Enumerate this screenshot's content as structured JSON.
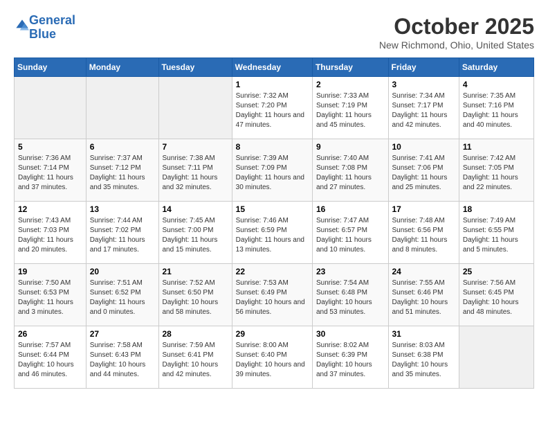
{
  "header": {
    "logo_line1": "General",
    "logo_line2": "Blue",
    "month": "October 2025",
    "location": "New Richmond, Ohio, United States"
  },
  "days_of_week": [
    "Sunday",
    "Monday",
    "Tuesday",
    "Wednesday",
    "Thursday",
    "Friday",
    "Saturday"
  ],
  "weeks": [
    [
      {
        "day": "",
        "info": ""
      },
      {
        "day": "",
        "info": ""
      },
      {
        "day": "",
        "info": ""
      },
      {
        "day": "1",
        "info": "Sunrise: 7:32 AM\nSunset: 7:20 PM\nDaylight: 11 hours and 47 minutes."
      },
      {
        "day": "2",
        "info": "Sunrise: 7:33 AM\nSunset: 7:19 PM\nDaylight: 11 hours and 45 minutes."
      },
      {
        "day": "3",
        "info": "Sunrise: 7:34 AM\nSunset: 7:17 PM\nDaylight: 11 hours and 42 minutes."
      },
      {
        "day": "4",
        "info": "Sunrise: 7:35 AM\nSunset: 7:16 PM\nDaylight: 11 hours and 40 minutes."
      }
    ],
    [
      {
        "day": "5",
        "info": "Sunrise: 7:36 AM\nSunset: 7:14 PM\nDaylight: 11 hours and 37 minutes."
      },
      {
        "day": "6",
        "info": "Sunrise: 7:37 AM\nSunset: 7:12 PM\nDaylight: 11 hours and 35 minutes."
      },
      {
        "day": "7",
        "info": "Sunrise: 7:38 AM\nSunset: 7:11 PM\nDaylight: 11 hours and 32 minutes."
      },
      {
        "day": "8",
        "info": "Sunrise: 7:39 AM\nSunset: 7:09 PM\nDaylight: 11 hours and 30 minutes."
      },
      {
        "day": "9",
        "info": "Sunrise: 7:40 AM\nSunset: 7:08 PM\nDaylight: 11 hours and 27 minutes."
      },
      {
        "day": "10",
        "info": "Sunrise: 7:41 AM\nSunset: 7:06 PM\nDaylight: 11 hours and 25 minutes."
      },
      {
        "day": "11",
        "info": "Sunrise: 7:42 AM\nSunset: 7:05 PM\nDaylight: 11 hours and 22 minutes."
      }
    ],
    [
      {
        "day": "12",
        "info": "Sunrise: 7:43 AM\nSunset: 7:03 PM\nDaylight: 11 hours and 20 minutes."
      },
      {
        "day": "13",
        "info": "Sunrise: 7:44 AM\nSunset: 7:02 PM\nDaylight: 11 hours and 17 minutes."
      },
      {
        "day": "14",
        "info": "Sunrise: 7:45 AM\nSunset: 7:00 PM\nDaylight: 11 hours and 15 minutes."
      },
      {
        "day": "15",
        "info": "Sunrise: 7:46 AM\nSunset: 6:59 PM\nDaylight: 11 hours and 13 minutes."
      },
      {
        "day": "16",
        "info": "Sunrise: 7:47 AM\nSunset: 6:57 PM\nDaylight: 11 hours and 10 minutes."
      },
      {
        "day": "17",
        "info": "Sunrise: 7:48 AM\nSunset: 6:56 PM\nDaylight: 11 hours and 8 minutes."
      },
      {
        "day": "18",
        "info": "Sunrise: 7:49 AM\nSunset: 6:55 PM\nDaylight: 11 hours and 5 minutes."
      }
    ],
    [
      {
        "day": "19",
        "info": "Sunrise: 7:50 AM\nSunset: 6:53 PM\nDaylight: 11 hours and 3 minutes."
      },
      {
        "day": "20",
        "info": "Sunrise: 7:51 AM\nSunset: 6:52 PM\nDaylight: 11 hours and 0 minutes."
      },
      {
        "day": "21",
        "info": "Sunrise: 7:52 AM\nSunset: 6:50 PM\nDaylight: 10 hours and 58 minutes."
      },
      {
        "day": "22",
        "info": "Sunrise: 7:53 AM\nSunset: 6:49 PM\nDaylight: 10 hours and 56 minutes."
      },
      {
        "day": "23",
        "info": "Sunrise: 7:54 AM\nSunset: 6:48 PM\nDaylight: 10 hours and 53 minutes."
      },
      {
        "day": "24",
        "info": "Sunrise: 7:55 AM\nSunset: 6:46 PM\nDaylight: 10 hours and 51 minutes."
      },
      {
        "day": "25",
        "info": "Sunrise: 7:56 AM\nSunset: 6:45 PM\nDaylight: 10 hours and 48 minutes."
      }
    ],
    [
      {
        "day": "26",
        "info": "Sunrise: 7:57 AM\nSunset: 6:44 PM\nDaylight: 10 hours and 46 minutes."
      },
      {
        "day": "27",
        "info": "Sunrise: 7:58 AM\nSunset: 6:43 PM\nDaylight: 10 hours and 44 minutes."
      },
      {
        "day": "28",
        "info": "Sunrise: 7:59 AM\nSunset: 6:41 PM\nDaylight: 10 hours and 42 minutes."
      },
      {
        "day": "29",
        "info": "Sunrise: 8:00 AM\nSunset: 6:40 PM\nDaylight: 10 hours and 39 minutes."
      },
      {
        "day": "30",
        "info": "Sunrise: 8:02 AM\nSunset: 6:39 PM\nDaylight: 10 hours and 37 minutes."
      },
      {
        "day": "31",
        "info": "Sunrise: 8:03 AM\nSunset: 6:38 PM\nDaylight: 10 hours and 35 minutes."
      },
      {
        "day": "",
        "info": ""
      }
    ]
  ]
}
